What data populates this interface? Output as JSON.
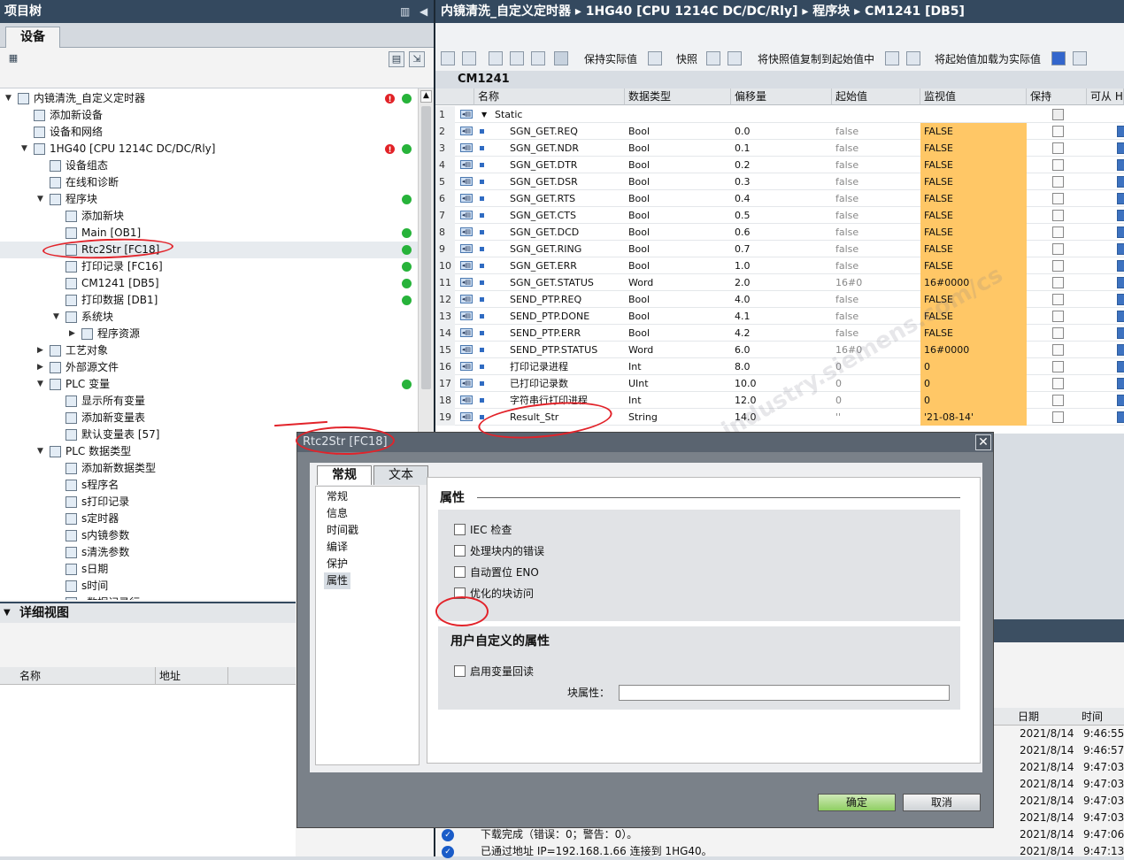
{
  "left_panel": {
    "title": "项目树",
    "tab": "设备",
    "tree": [
      {
        "label": "内镜清洗_自定义定时器",
        "indent": 0,
        "tw": "▼",
        "status": "red_green"
      },
      {
        "label": "添加新设备",
        "indent": 1
      },
      {
        "label": "设备和网络",
        "indent": 1
      },
      {
        "label": "1HG40 [CPU 1214C DC/DC/Rly]",
        "indent": 1,
        "tw": "▼",
        "status": "warn_green"
      },
      {
        "label": "设备组态",
        "indent": 2
      },
      {
        "label": "在线和诊断",
        "indent": 2
      },
      {
        "label": "程序块",
        "indent": 2,
        "tw": "▼",
        "status": "green"
      },
      {
        "label": "添加新块",
        "indent": 3
      },
      {
        "label": "Main [OB1]",
        "indent": 3,
        "status": "green"
      },
      {
        "label": "Rtc2Str [FC18]",
        "indent": 3,
        "status": "green",
        "selected": true
      },
      {
        "label": "打印记录 [FC16]",
        "indent": 3,
        "status": "green"
      },
      {
        "label": "CM1241 [DB5]",
        "indent": 3,
        "status": "green"
      },
      {
        "label": "打印数据 [DB1]",
        "indent": 3,
        "status": "green"
      },
      {
        "label": "系统块",
        "indent": 3,
        "tw": "▼"
      },
      {
        "label": "程序资源",
        "indent": 4,
        "tw": "▶"
      },
      {
        "label": "工艺对象",
        "indent": 2,
        "tw": "▶"
      },
      {
        "label": "外部源文件",
        "indent": 2,
        "tw": "▶"
      },
      {
        "label": "PLC 变量",
        "indent": 2,
        "tw": "▼",
        "status": "green"
      },
      {
        "label": "显示所有变量",
        "indent": 3
      },
      {
        "label": "添加新变量表",
        "indent": 3
      },
      {
        "label": "默认变量表 [57]",
        "indent": 3
      },
      {
        "label": "PLC 数据类型",
        "indent": 2,
        "tw": "▼"
      },
      {
        "label": "添加新数据类型",
        "indent": 3
      },
      {
        "label": "s程序名",
        "indent": 3
      },
      {
        "label": "s打印记录",
        "indent": 3
      },
      {
        "label": "s定时器",
        "indent": 3
      },
      {
        "label": "s内镜参数",
        "indent": 3
      },
      {
        "label": "s清洗参数",
        "indent": 3
      },
      {
        "label": "s日期",
        "indent": 3
      },
      {
        "label": "s时间",
        "indent": 3
      },
      {
        "label": "s数据记录行",
        "indent": 3
      }
    ],
    "detail_title": "详细视图",
    "detail_cols": [
      "名称",
      "地址"
    ]
  },
  "right_panel": {
    "breadcrumb": "内镜清洗_自定义定时器 ▸ 1HG40 [CPU 1214C DC/DC/Rly] ▸ 程序块 ▸ CM1241 [DB5]",
    "toolbar": {
      "keep_actual": "保持实际值",
      "snapshot": "快照",
      "copy_snapshot": "将快照值复制到起始值中",
      "load_start": "将起始值加载为实际值"
    },
    "db_name": "CM1241",
    "columns": [
      "名称",
      "数据类型",
      "偏移量",
      "起始值",
      "监视值",
      "保持",
      "可从 H"
    ],
    "rows": [
      {
        "n": "1",
        "name": "Static",
        "type": "",
        "off": "",
        "start": "",
        "mon": "",
        "hdr": true
      },
      {
        "n": "2",
        "name": "SGN_GET.REQ",
        "type": "Bool",
        "off": "0.0",
        "start": "false",
        "mon": "FALSE"
      },
      {
        "n": "3",
        "name": "SGN_GET.NDR",
        "type": "Bool",
        "off": "0.1",
        "start": "false",
        "mon": "FALSE"
      },
      {
        "n": "4",
        "name": "SGN_GET.DTR",
        "type": "Bool",
        "off": "0.2",
        "start": "false",
        "mon": "FALSE"
      },
      {
        "n": "5",
        "name": "SGN_GET.DSR",
        "type": "Bool",
        "off": "0.3",
        "start": "false",
        "mon": "FALSE"
      },
      {
        "n": "6",
        "name": "SGN_GET.RTS",
        "type": "Bool",
        "off": "0.4",
        "start": "false",
        "mon": "FALSE"
      },
      {
        "n": "7",
        "name": "SGN_GET.CTS",
        "type": "Bool",
        "off": "0.5",
        "start": "false",
        "mon": "FALSE"
      },
      {
        "n": "8",
        "name": "SGN_GET.DCD",
        "type": "Bool",
        "off": "0.6",
        "start": "false",
        "mon": "FALSE"
      },
      {
        "n": "9",
        "name": "SGN_GET.RING",
        "type": "Bool",
        "off": "0.7",
        "start": "false",
        "mon": "FALSE"
      },
      {
        "n": "10",
        "name": "SGN_GET.ERR",
        "type": "Bool",
        "off": "1.0",
        "start": "false",
        "mon": "FALSE"
      },
      {
        "n": "11",
        "name": "SGN_GET.STATUS",
        "type": "Word",
        "off": "2.0",
        "start": "16#0",
        "mon": "16#0000"
      },
      {
        "n": "12",
        "name": "SEND_PTP.REQ",
        "type": "Bool",
        "off": "4.0",
        "start": "false",
        "mon": "FALSE"
      },
      {
        "n": "13",
        "name": "SEND_PTP.DONE",
        "type": "Bool",
        "off": "4.1",
        "start": "false",
        "mon": "FALSE"
      },
      {
        "n": "14",
        "name": "SEND_PTP.ERR",
        "type": "Bool",
        "off": "4.2",
        "start": "false",
        "mon": "FALSE"
      },
      {
        "n": "15",
        "name": "SEND_PTP.STATUS",
        "type": "Word",
        "off": "6.0",
        "start": "16#0",
        "mon": "16#0000"
      },
      {
        "n": "16",
        "name": "打印记录进程",
        "type": "Int",
        "off": "8.0",
        "start": "0",
        "mon": "0"
      },
      {
        "n": "17",
        "name": "已打印记录数",
        "type": "UInt",
        "off": "10.0",
        "start": "0",
        "mon": "0"
      },
      {
        "n": "18",
        "name": "字符串行打印进程",
        "type": "Int",
        "off": "12.0",
        "start": "0",
        "mon": "0"
      },
      {
        "n": "19",
        "name": "Result_Str",
        "type": "String",
        "off": "14.0",
        "start": "''",
        "mon": "'21-08-14'"
      }
    ],
    "log": {
      "cols": [
        "日期",
        "时间"
      ],
      "rows": [
        {
          "date": "2021/8/14",
          "time": "9:46:55",
          "msg": ""
        },
        {
          "date": "2021/8/14",
          "time": "9:46:57",
          "msg": ""
        },
        {
          "date": "2021/8/14",
          "time": "9:47:03",
          "msg": ""
        },
        {
          "date": "2021/8/14",
          "time": "9:47:03",
          "msg": ""
        },
        {
          "date": "2021/8/14",
          "time": "9:47:03",
          "msg": ""
        },
        {
          "date": "2021/8/14",
          "time": "9:47:03",
          "msg": ""
        },
        {
          "date": "2021/8/14",
          "time": "9:47:06",
          "msg": "下载完成（错误：0；警告：0）。"
        },
        {
          "date": "2021/8/14",
          "time": "9:47:13",
          "msg": "已通过地址 IP=192.168.1.66 连接到 1HG40。"
        }
      ]
    }
  },
  "dialog": {
    "title": "Rtc2Str [FC18]",
    "tabs": [
      "常规",
      "文本"
    ],
    "nav": [
      "常规",
      "信息",
      "时间戳",
      "编译",
      "保护",
      "属性"
    ],
    "active_nav": "属性",
    "section_title": "属性",
    "options": [
      "IEC 检查",
      "处理块内的错误",
      "自动置位 ENO",
      "优化的块访问"
    ],
    "user_section": "用户自定义的属性",
    "user_option": "启用变量回读",
    "block_prop_label": "块属性：",
    "block_prop_value": "",
    "ok": "确定",
    "cancel": "取消"
  },
  "watermark": "西门子工业技术论坛 support.industry.siemens.com/cs"
}
